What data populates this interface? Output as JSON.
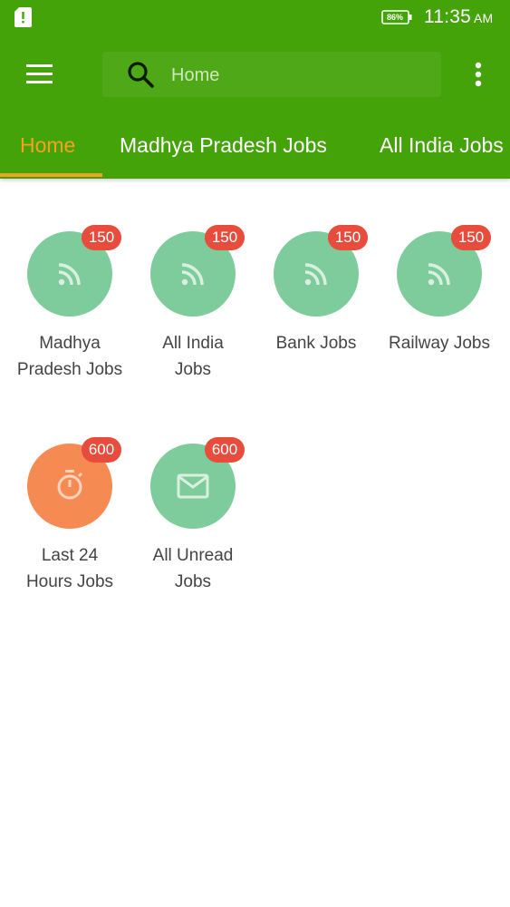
{
  "status_bar": {
    "battery": "86%",
    "time": "11:35",
    "ampm": "AM",
    "icons": [
      "sim-alert-icon",
      "battery-icon"
    ]
  },
  "toolbar": {
    "search_placeholder": "Home",
    "icons": [
      "hamburger-menu-icon",
      "search-icon",
      "more-vert-icon"
    ]
  },
  "tabs": [
    {
      "label": "Home",
      "active": true
    },
    {
      "label": "Madhya Pradesh Jobs",
      "active": false
    },
    {
      "label": "All India Jobs",
      "active": false
    }
  ],
  "categories": [
    {
      "line1": "Madhya",
      "line2": "Pradesh Jobs",
      "count": "150",
      "icon": "rss-feed-icon",
      "color": "#7ecb9c"
    },
    {
      "line1": "All India",
      "line2": "Jobs",
      "count": "150",
      "icon": "rss-feed-icon",
      "color": "#7ecb9c"
    },
    {
      "line1": "Bank Jobs",
      "line2": "",
      "count": "150",
      "icon": "rss-feed-icon",
      "color": "#7ecb9c"
    },
    {
      "line1": "Railway Jobs",
      "line2": "",
      "count": "150",
      "icon": "rss-feed-icon",
      "color": "#7ecb9c"
    },
    {
      "line1": "Last 24",
      "line2": "Hours Jobs",
      "count": "600",
      "icon": "timer-icon",
      "color": "#f58b52"
    },
    {
      "line1": "All Unread",
      "line2": "Jobs",
      "count": "600",
      "icon": "mail-icon",
      "color": "#7ecb9c"
    }
  ],
  "colors": {
    "app_bar": "#45a30a",
    "accent": "#f4a11f",
    "badge": "#e84c3d"
  }
}
